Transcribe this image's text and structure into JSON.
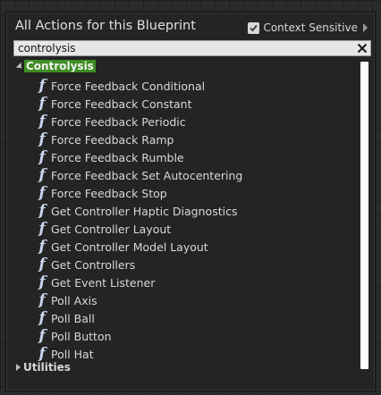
{
  "header": {
    "title": "All Actions for this Blueprint",
    "context_sensitive_label": "Context Sensitive",
    "context_sensitive_checked": true
  },
  "search": {
    "value": "controlysis"
  },
  "tree": {
    "categories": [
      {
        "label": "Controlysis",
        "expanded": true,
        "highlighted": true
      },
      {
        "label": "Utilities",
        "expanded": false,
        "highlighted": false
      }
    ],
    "items": [
      "Force Feedback Conditional",
      "Force Feedback Constant",
      "Force Feedback Periodic",
      "Force Feedback Ramp",
      "Force Feedback Rumble",
      "Force Feedback Set Autocentering",
      "Force Feedback Stop",
      "Get Controller Haptic Diagnostics",
      "Get Controller Layout",
      "Get Controller Model Layout",
      "Get Controllers",
      "Get Event Listener",
      "Poll Axis",
      "Poll Ball",
      "Poll Button",
      "Poll Hat"
    ],
    "item_icon": "function-icon"
  },
  "colors": {
    "highlight": "#3f8f24",
    "function_icon": "#c8d6ef",
    "panel": "#242424"
  }
}
